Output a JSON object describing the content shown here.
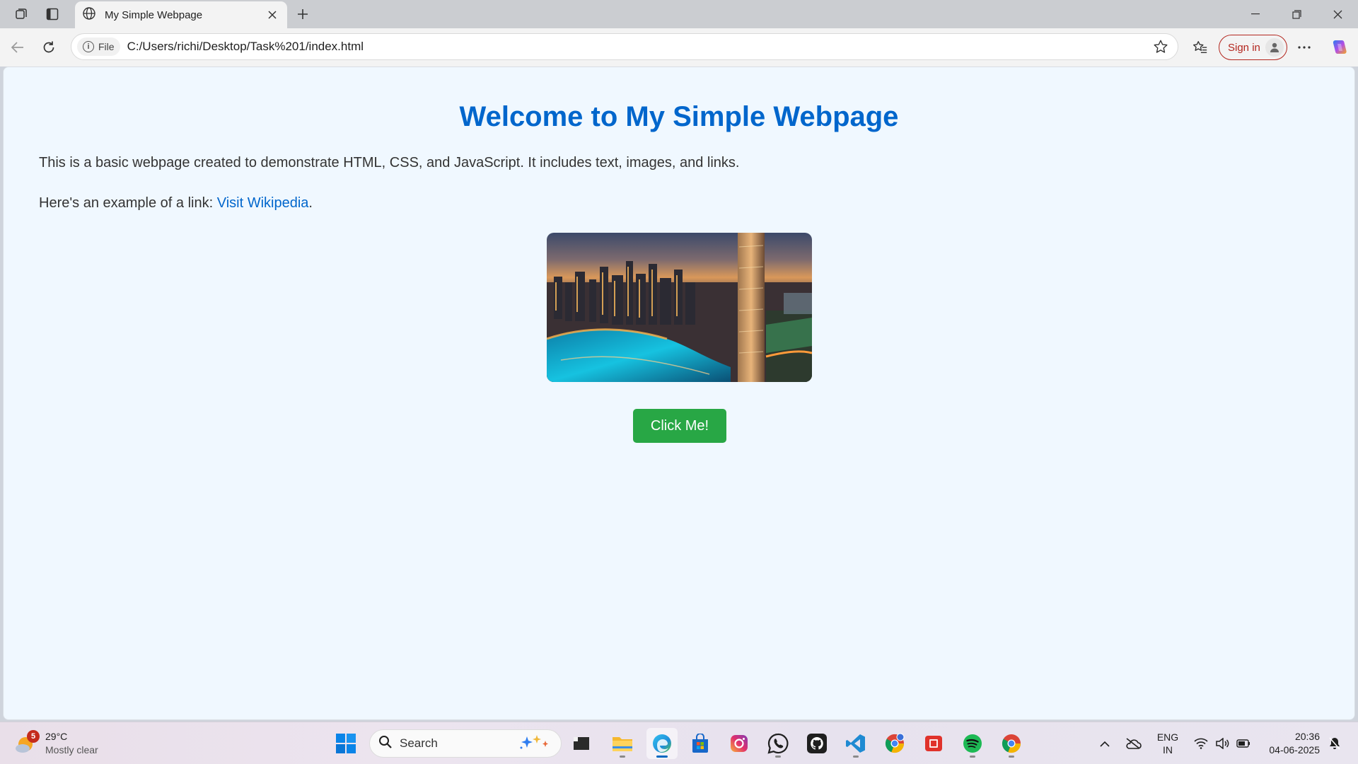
{
  "browser": {
    "tab_title": "My Simple Webpage",
    "file_chip": "File",
    "url": "C:/Users/richi/Desktop/Task%201/index.html",
    "signin_label": "Sign in"
  },
  "page": {
    "heading": "Welcome to My Simple Webpage",
    "intro": "This is a basic webpage created to demonstrate HTML, CSS, and JavaScript. It includes text, images, and links.",
    "link_prefix": "Here's an example of a link: ",
    "link_text": "Visit Wikipedia",
    "link_suffix": ".",
    "button_label": "Click Me!",
    "colors": {
      "heading": "#0066cc",
      "background": "#f0f8ff",
      "button": "#28a745"
    }
  },
  "taskbar": {
    "weather": {
      "badge": "5",
      "temp": "29°C",
      "condition": "Mostly clear"
    },
    "search_placeholder": "Search",
    "apps": [
      "file-explorer-cmd-icon",
      "folder-icon",
      "edge-icon",
      "store-icon",
      "instagram-icon",
      "whatsapp-icon",
      "github-icon",
      "vscode-icon",
      "chrome-profile-icon",
      "app-red-icon",
      "spotify-icon",
      "chrome-icon"
    ],
    "lang_top": "ENG",
    "lang_bottom": "IN",
    "time": "20:36",
    "date": "04-06-2025"
  }
}
